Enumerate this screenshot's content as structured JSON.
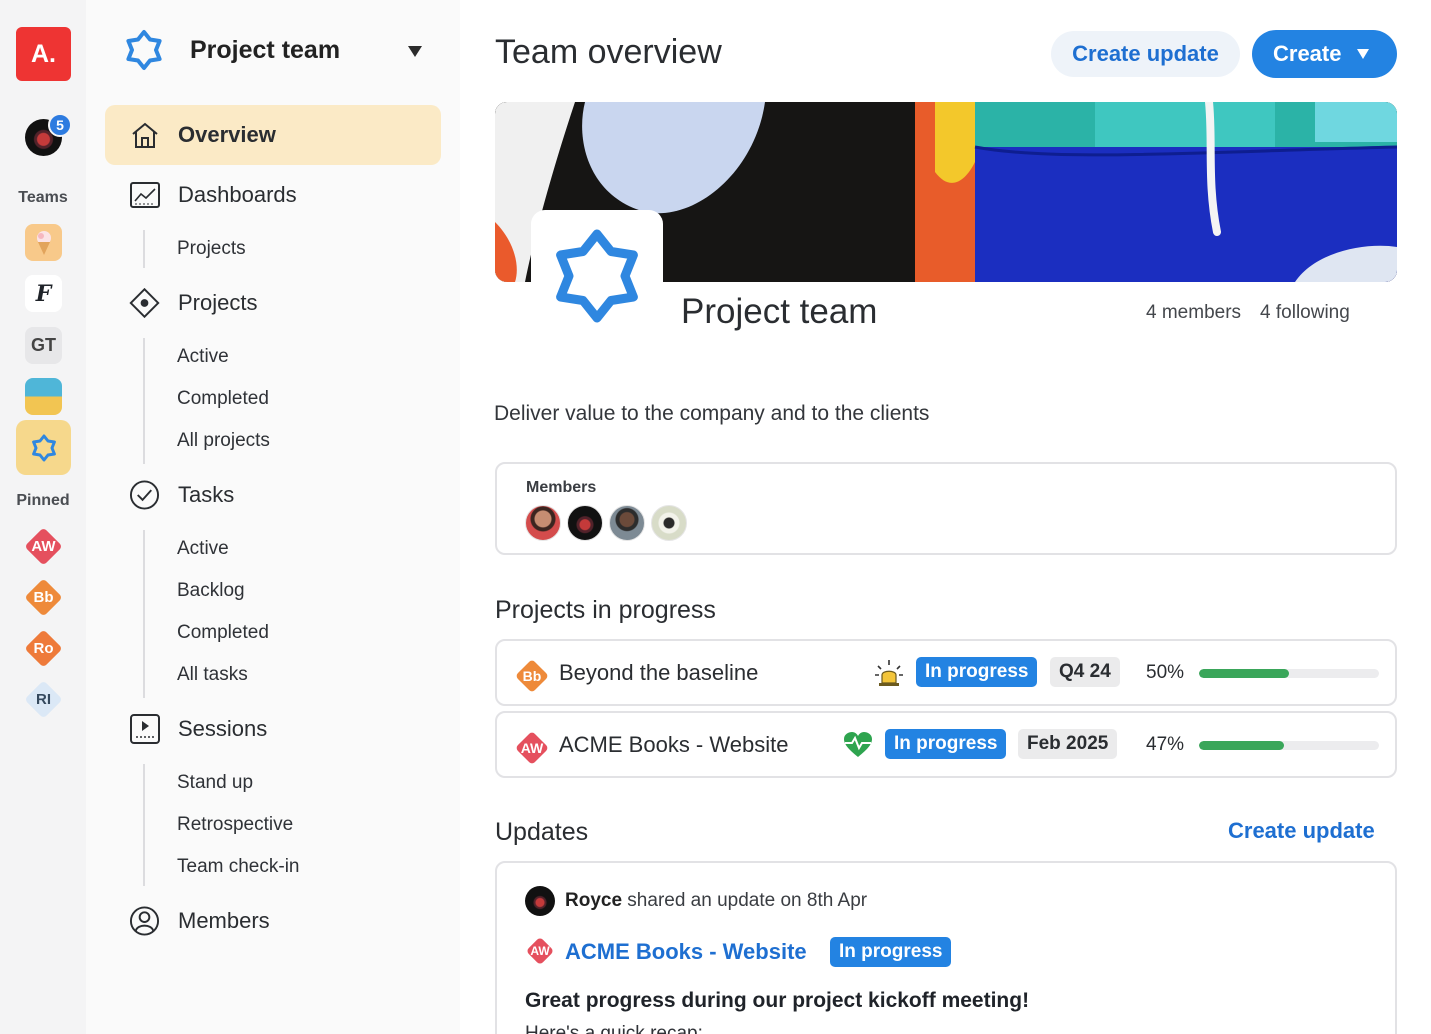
{
  "rail": {
    "logo": "A.",
    "notification_count": "5",
    "teams_label": "Teams",
    "teams": [
      {
        "icon": "ice-cream-icon"
      },
      {
        "label": "F"
      },
      {
        "label": "GT"
      },
      {
        "icon": "beach-icon"
      },
      {
        "icon": "star-team-icon"
      }
    ],
    "pinned_label": "Pinned",
    "pinned": [
      {
        "label": "AW",
        "color": "#e5505e"
      },
      {
        "label": "Bb",
        "color": "#ee8a3a"
      },
      {
        "label": "Ro",
        "color": "#ee7a3a"
      },
      {
        "label": "RI",
        "color": "#dbe8f6"
      }
    ]
  },
  "sidebar": {
    "team_name": "Project team",
    "overview": "Overview",
    "dashboards": "Dashboards",
    "dashboards_sub": [
      "Projects"
    ],
    "projects": "Projects",
    "projects_sub": [
      "Active",
      "Completed",
      "All projects"
    ],
    "tasks": "Tasks",
    "tasks_sub": [
      "Active",
      "Backlog",
      "Completed",
      "All tasks"
    ],
    "sessions": "Sessions",
    "sessions_sub": [
      "Stand up",
      "Retrospective",
      "Team check-in"
    ],
    "members": "Members"
  },
  "header": {
    "title": "Team overview",
    "create_update": "Create update",
    "create": "Create"
  },
  "team": {
    "name": "Project team",
    "members_count": "4 members",
    "following_count": "4 following",
    "description": "Deliver value to the company and to the clients"
  },
  "members_card": {
    "label": "Members"
  },
  "projects_section": {
    "title": "Projects in progress",
    "rows": [
      {
        "badge": "Bb",
        "badge_color": "#ee8a3a",
        "name": "Beyond the baseline",
        "health_icon": "siren-icon",
        "status": "In progress",
        "date": "Q4 24",
        "percent": "50%",
        "progress": 0.5
      },
      {
        "badge": "AW",
        "badge_color": "#e5505e",
        "name": "ACME Books - Website",
        "health_icon": "heartbeat-icon",
        "status": "In progress",
        "date": "Feb 2025",
        "percent": "47%",
        "progress": 0.47
      }
    ]
  },
  "updates": {
    "title": "Updates",
    "create_update": "Create update",
    "item": {
      "author": "Royce",
      "action": " shared an update on 8th Apr",
      "project_badge": "AW",
      "project": "ACME Books - Website",
      "status": "In progress",
      "headline": "Great progress during our project kickoff meeting!",
      "preview": "Here's a quick recap:"
    }
  }
}
